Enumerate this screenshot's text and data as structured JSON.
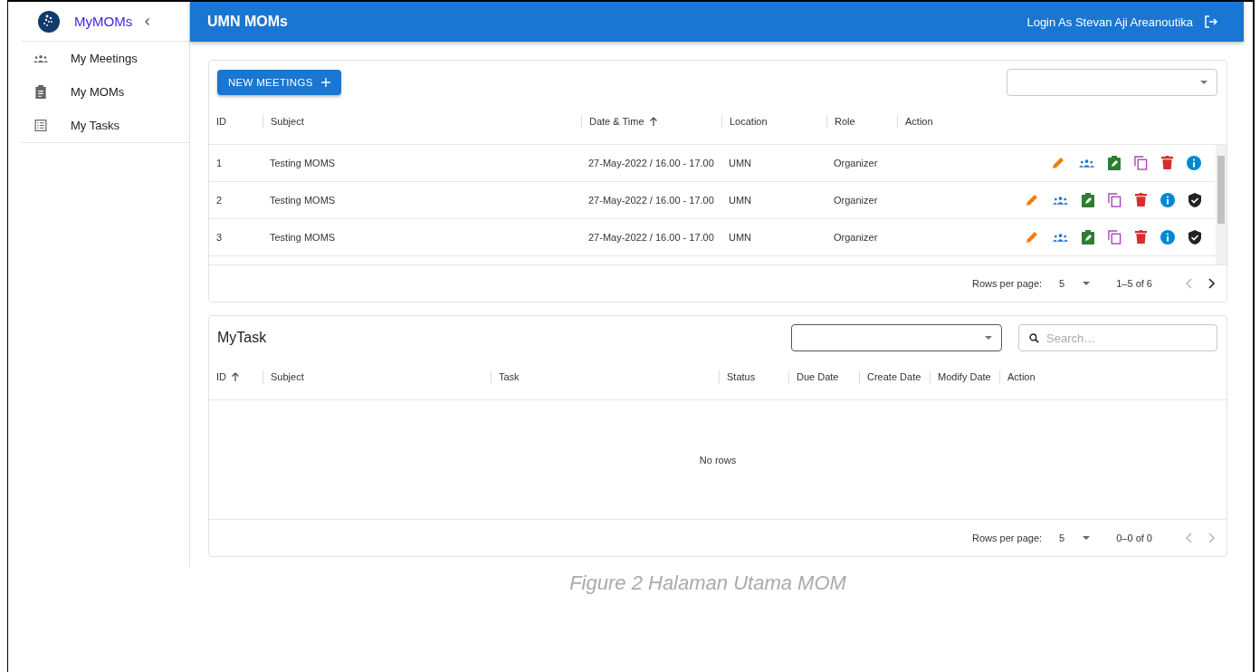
{
  "sidebar": {
    "app_name": "MyMOMs",
    "items": [
      {
        "label": "My Meetings",
        "kind": "meetings",
        "selected": false
      },
      {
        "label": "My MOMs",
        "kind": "clipboard",
        "selected": false
      },
      {
        "label": "My Tasks",
        "kind": "list",
        "selected": false
      }
    ]
  },
  "topbar": {
    "title": "UMN MOMs",
    "user": "Login As Stevan Aji Areanoutika"
  },
  "meetings": {
    "new_button": "NEW MEETINGS",
    "columns": [
      {
        "label": "ID",
        "sorted": false
      },
      {
        "label": "Subject",
        "sorted": false
      },
      {
        "label": "Date & Time",
        "sorted": true
      },
      {
        "label": "Location",
        "sorted": false
      },
      {
        "label": "Role",
        "sorted": false
      },
      {
        "label": "Action",
        "sorted": false
      }
    ],
    "rows": [
      {
        "id": "1",
        "subject": "Testing MOMS",
        "datetime": "27-May-2022 / 16.00 - 17.00",
        "location": "UMN",
        "role": "Organizer",
        "actions": [
          {
            "kind": "edit"
          },
          {
            "kind": "members"
          },
          {
            "kind": "mom"
          },
          {
            "kind": "copy"
          },
          {
            "kind": "delete"
          },
          {
            "kind": "info"
          }
        ]
      },
      {
        "id": "2",
        "subject": "Testing MOMS",
        "datetime": "27-May-2022 / 16.00 - 17.00",
        "location": "UMN",
        "role": "Organizer",
        "actions": [
          {
            "kind": "edit"
          },
          {
            "kind": "members"
          },
          {
            "kind": "mom"
          },
          {
            "kind": "copy"
          },
          {
            "kind": "delete"
          },
          {
            "kind": "info"
          },
          {
            "kind": "shield"
          }
        ]
      },
      {
        "id": "3",
        "subject": "Testing MOMS",
        "datetime": "27-May-2022 / 16.00 - 17.00",
        "location": "UMN",
        "role": "Organizer",
        "actions": [
          {
            "kind": "edit"
          },
          {
            "kind": "members"
          },
          {
            "kind": "mom"
          },
          {
            "kind": "copy"
          },
          {
            "kind": "delete"
          },
          {
            "kind": "info"
          },
          {
            "kind": "shield"
          }
        ]
      }
    ],
    "pagination": {
      "label": "Rows per page:",
      "rows_per_page": "5",
      "range": "1–5 of 6",
      "prev_disabled": true,
      "next_disabled": false
    }
  },
  "tasks": {
    "title": "MyTask",
    "search": {
      "placeholder": "Search…"
    },
    "columns": [
      {
        "label": "ID",
        "sorted": true
      },
      {
        "label": "Subject",
        "sorted": false
      },
      {
        "label": "Task",
        "sorted": false
      },
      {
        "label": "Status",
        "sorted": false
      },
      {
        "label": "Due Date",
        "sorted": false
      },
      {
        "label": "Create Date",
        "sorted": false
      },
      {
        "label": "Modify Date",
        "sorted": false
      },
      {
        "label": "Action",
        "sorted": false
      }
    ],
    "empty_message": "No rows",
    "pagination": {
      "label": "Rows per page:",
      "rows_per_page": "5",
      "range": "0–0 of 0",
      "prev_disabled": true,
      "next_disabled": true
    }
  },
  "caption": "Figure 2 Halaman Utama MOM"
}
